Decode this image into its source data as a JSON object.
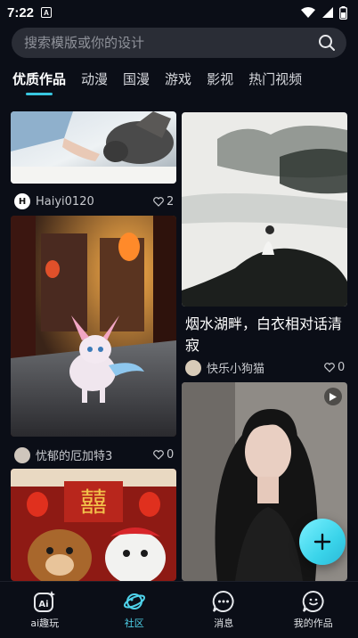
{
  "status_bar": {
    "time": "7:22",
    "notification_letter": "A"
  },
  "search": {
    "placeholder": "搜索模版或你的设计"
  },
  "tabs": [
    {
      "label": "优质作品",
      "active": true
    },
    {
      "label": "动漫"
    },
    {
      "label": "国漫"
    },
    {
      "label": "游戏"
    },
    {
      "label": "影视"
    },
    {
      "label": "热门视频"
    }
  ],
  "feed": {
    "left": [
      {
        "author": "Haiyi0120",
        "avatar_letter": "H",
        "likes": "2"
      },
      {
        "author": "忧郁的厄加特3",
        "likes": "0"
      },
      {
        "author": "",
        "likes": ""
      }
    ],
    "right": [
      {
        "title": "烟水湖畔，白衣相对话清寂",
        "author": "快乐小狗猫",
        "likes": "0"
      },
      {
        "author": "",
        "likes": ""
      }
    ]
  },
  "bottom_nav": [
    {
      "label": "ai趣玩",
      "icon": "ai-icon"
    },
    {
      "label": "社区",
      "icon": "planet-icon",
      "active": true
    },
    {
      "label": "消息",
      "icon": "chat-icon"
    },
    {
      "label": "我的作品",
      "icon": "works-icon"
    }
  ],
  "colors": {
    "accent": "#38c6e0",
    "background": "#0b0e17",
    "search_bg": "#2a2d36"
  }
}
